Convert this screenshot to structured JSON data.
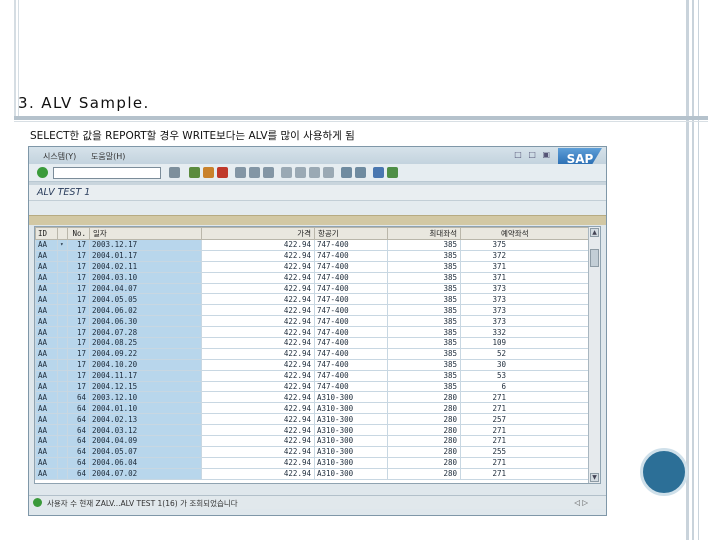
{
  "slide": {
    "heading": "3. ALV Sample.",
    "caption": "SELECT한 값을 REPORT할 경우 WRITE보다는 ALV를 많이 사용하게 됨"
  },
  "sap": {
    "menu": [
      "시스템(Y)",
      "도움말(H)"
    ],
    "logo": "SAP",
    "window_icons": "□ □ ▣",
    "title": "ALV TEST 1",
    "columns": [
      "ID",
      "No.",
      "일자",
      "가격",
      "항공기",
      "최대좌석",
      "예약좌석"
    ],
    "rows": [
      [
        "AA",
        "17",
        "2003.12.17",
        "422.94",
        "747-400",
        "385",
        "375"
      ],
      [
        "AA",
        "17",
        "2004.01.17",
        "422.94",
        "747-400",
        "385",
        "372"
      ],
      [
        "AA",
        "17",
        "2004.02.11",
        "422.94",
        "747-400",
        "385",
        "371"
      ],
      [
        "AA",
        "17",
        "2004.03.10",
        "422.94",
        "747-400",
        "385",
        "371"
      ],
      [
        "AA",
        "17",
        "2004.04.07",
        "422.94",
        "747-400",
        "385",
        "373"
      ],
      [
        "AA",
        "17",
        "2004.05.05",
        "422.94",
        "747-400",
        "385",
        "373"
      ],
      [
        "AA",
        "17",
        "2004.06.02",
        "422.94",
        "747-400",
        "385",
        "373"
      ],
      [
        "AA",
        "17",
        "2004.06.30",
        "422.94",
        "747-400",
        "385",
        "373"
      ],
      [
        "AA",
        "17",
        "2004.07.28",
        "422.94",
        "747-400",
        "385",
        "332"
      ],
      [
        "AA",
        "17",
        "2004.08.25",
        "422.94",
        "747-400",
        "385",
        "109"
      ],
      [
        "AA",
        "17",
        "2004.09.22",
        "422.94",
        "747-400",
        "385",
        "52"
      ],
      [
        "AA",
        "17",
        "2004.10.20",
        "422.94",
        "747-400",
        "385",
        "30"
      ],
      [
        "AA",
        "17",
        "2004.11.17",
        "422.94",
        "747-400",
        "385",
        "53"
      ],
      [
        "AA",
        "17",
        "2004.12.15",
        "422.94",
        "747-400",
        "385",
        "6"
      ],
      [
        "AA",
        "64",
        "2003.12.10",
        "422.94",
        "A310-300",
        "280",
        "271"
      ],
      [
        "AA",
        "64",
        "2004.01.10",
        "422.94",
        "A310-300",
        "280",
        "271"
      ],
      [
        "AA",
        "64",
        "2004.02.13",
        "422.94",
        "A310-300",
        "280",
        "257"
      ],
      [
        "AA",
        "64",
        "2004.03.12",
        "422.94",
        "A310-300",
        "280",
        "271"
      ],
      [
        "AA",
        "64",
        "2004.04.09",
        "422.94",
        "A310-300",
        "280",
        "271"
      ],
      [
        "AA",
        "64",
        "2004.05.07",
        "422.94",
        "A310-300",
        "280",
        "255"
      ],
      [
        "AA",
        "64",
        "2004.06.04",
        "422.94",
        "A310-300",
        "280",
        "271"
      ],
      [
        "AA",
        "64",
        "2004.07.02",
        "422.94",
        "A310-300",
        "280",
        "271"
      ]
    ],
    "status_text": "사용자 수 현재 ZALV...ALV TEST 1(16) 가 조회되었습니다",
    "status_end": "◁ ▷"
  },
  "colors": {
    "key_cell": "#b8d6ec",
    "price_text": "#cc1212",
    "accent_circle": "#2c6f97"
  }
}
